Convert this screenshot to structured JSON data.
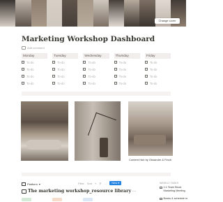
{
  "cover": {
    "colors": [
      "#3a3430",
      "#bdb3a9",
      "#8e7e70",
      "#d7cfc6",
      "#5e534b",
      "#a79888",
      "#cfc8bf",
      "#473f39",
      "#b6aa9c",
      "#7d6f63",
      "#e0d9d2",
      "#423b35"
    ]
  },
  "cover_button": "Change cover",
  "page_title": "Marketing Workshop Dashboard",
  "add_comment": "Add comment",
  "week": [
    {
      "day": "Monday",
      "todos": [
        "To-do",
        "To-do",
        "To-do",
        "To-do"
      ]
    },
    {
      "day": "Tuesday",
      "todos": [
        "To-do",
        "To-do",
        "To-do",
        "To-do"
      ]
    },
    {
      "day": "Wednesday",
      "todos": [
        "To-do",
        "To-do",
        "To-do",
        "To-do"
      ]
    },
    {
      "day": "Thursday",
      "todos": [
        "To-do",
        "To-do",
        "To-do",
        "To-do"
      ]
    },
    {
      "day": "Friday",
      "todos": [
        "To-do",
        "To-do",
        "To-do",
        "To-do"
      ]
    }
  ],
  "image_caption": "Content Hub by Oksander & Finch",
  "database": {
    "view_label": "Platform",
    "filter": "Filter",
    "sort": "Sort",
    "new_button": "New",
    "title": "The marketing workshop_resource library"
  },
  "weekly_tasks": {
    "label": "WEEKLY TASKS",
    "items": [
      "1:1 Team Block Marketing Meeting",
      "Books & schedule m"
    ]
  },
  "tag_colors": [
    "#d6ead8",
    "#f6dccb",
    "#dbe7f5"
  ]
}
